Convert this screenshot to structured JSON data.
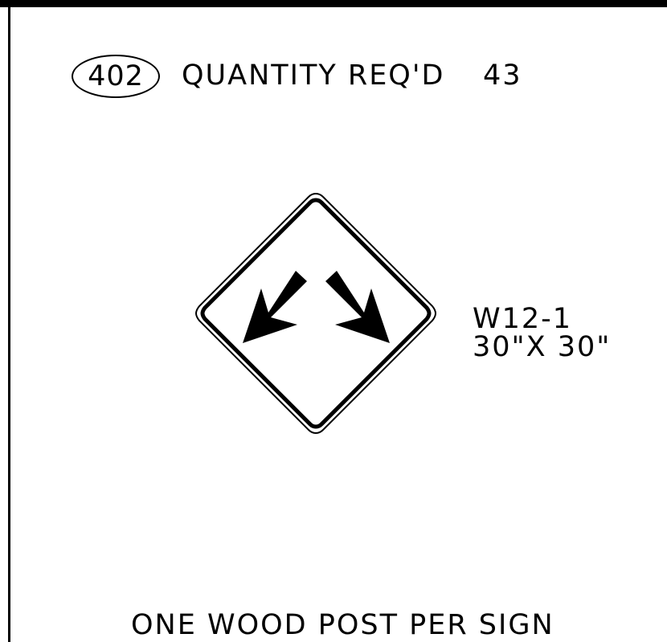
{
  "item_number": "402",
  "quantity": {
    "label": "QUANTITY REQ'D",
    "value": "43"
  },
  "sign": {
    "code": "W12-1",
    "size": "30\"X 30\"",
    "symbol": "double-arrow-divided-highway-icon",
    "background_color": "#ffffff",
    "legend_color": "#000000"
  },
  "footer_note": "ONE WOOD POST PER SIGN"
}
